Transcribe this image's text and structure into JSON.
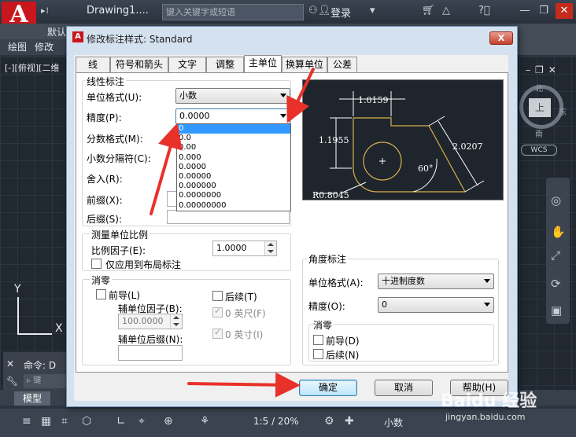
{
  "app": {
    "logo": "A",
    "doc_title": "Drawing1....",
    "search_placeholder": "键入关键字或短语",
    "login": "登录",
    "ribbon_tab": "默认",
    "menu": [
      "绘图",
      "修改"
    ],
    "view_label": "[-][俯视][二维",
    "viewcube": {
      "face": "上",
      "north": "北",
      "east": "东",
      "south": "南",
      "wcs": "WCS"
    },
    "command_label": "命令: D",
    "command_input_placeholder": "键",
    "ucs": {
      "x": "X",
      "y": "Y"
    },
    "model_tab": "模型",
    "status": {
      "scale": "1:5 / 20%",
      "units": "小数"
    }
  },
  "dialog": {
    "title": "修改标注样式: Standard",
    "close": "X",
    "tabs": [
      "线",
      "符号和箭头",
      "文字",
      "调整",
      "主单位",
      "换算单位",
      "公差"
    ],
    "active_tab": "主单位",
    "linear": {
      "title": "线性标注",
      "unit_format_label": "单位格式(U):",
      "unit_format_value": "小数",
      "precision_label": "精度(P):",
      "precision_value": "0.0000",
      "precision_options": [
        "0",
        "0.0",
        "0.00",
        "0.000",
        "0.0000",
        "0.00000",
        "0.000000",
        "0.0000000",
        "0.00000000"
      ],
      "precision_selected_index": 0,
      "fraction_format_label": "分数格式(M):",
      "decimal_sep_label": "小数分隔符(C):",
      "round_label": "舍入(R):",
      "prefix_label": "前缀(X):",
      "suffix_label": "后缀(S):"
    },
    "scale": {
      "title": "测量单位比例",
      "factor_label": "比例因子(E):",
      "factor_value": "1.0000",
      "layout_only_label": "仅应用到布局标注"
    },
    "zero_suppress_linear": {
      "title": "消零",
      "leading_label": "前导(L)",
      "sub_unit_factor_label": "辅单位因子(B):",
      "sub_unit_factor_value": "100.0000",
      "sub_unit_suffix_label": "辅单位后缀(N):",
      "trailing_label": "后续(T)",
      "feet_label": "0 英尺(F)",
      "inches_label": "0 英寸(I)"
    },
    "preview": {
      "dim_top": "1.0159",
      "dim_left": "1.1955",
      "dim_right": "2.0207",
      "angle": "60°",
      "radius": "R0.8045"
    },
    "angular": {
      "title": "角度标注",
      "unit_format_label": "单位格式(A):",
      "unit_format_value": "十进制度数",
      "precision_label": "精度(O):",
      "precision_value": "0",
      "zero_title": "消零",
      "leading_label": "前导(D)",
      "trailing_label": "后续(N)"
    },
    "buttons": {
      "ok": "确定",
      "cancel": "取消",
      "help": "帮助(H)"
    }
  },
  "watermark": {
    "brand": "Baidu 经验",
    "url": "jingyan.baidu.com"
  },
  "colors": {
    "arrow": "#e8312a",
    "selection": "#3399ff",
    "preview_lines": "#ffffff",
    "preview_shape": "#d8b04a"
  }
}
